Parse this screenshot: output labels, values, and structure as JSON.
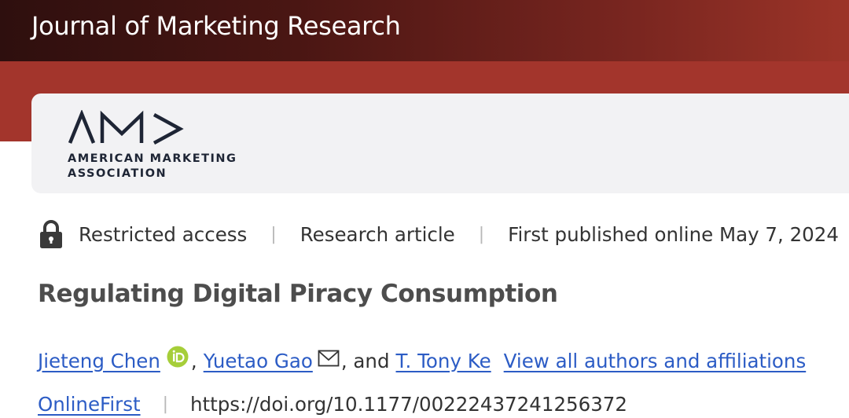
{
  "header": {
    "journal_title": "Journal of Marketing Research"
  },
  "publisher": {
    "logo_icon": "ama-logo-mark",
    "name_line1": "AMERICAN MARKETING",
    "name_line2": "ASSOCIATION"
  },
  "meta": {
    "access_icon": "lock-icon",
    "access_label": "Restricted access",
    "article_type": "Research article",
    "published": "First published online May 7, 2024"
  },
  "article": {
    "title": "Regulating Digital Piracy Consumption"
  },
  "authors": {
    "list": [
      {
        "name": "Jieteng Chen",
        "icon": "orcid-icon"
      },
      {
        "name": "Yuetao Gao",
        "icon": "mail-icon"
      },
      {
        "name": "T. Tony Ke"
      }
    ],
    "separator_comma": ",",
    "separator_and": ", and",
    "view_all_label": "View all authors and affiliations"
  },
  "doi_row": {
    "online_first_label": "OnlineFirst",
    "doi": "https://doi.org/10.1177/00222437241256372"
  },
  "colors": {
    "header_dark": "#2e0f0e",
    "header_red": "#a3352c",
    "link_blue": "#2c5cc5",
    "orcid_green": "#a6ce39",
    "logo_navy": "#1e2535"
  }
}
